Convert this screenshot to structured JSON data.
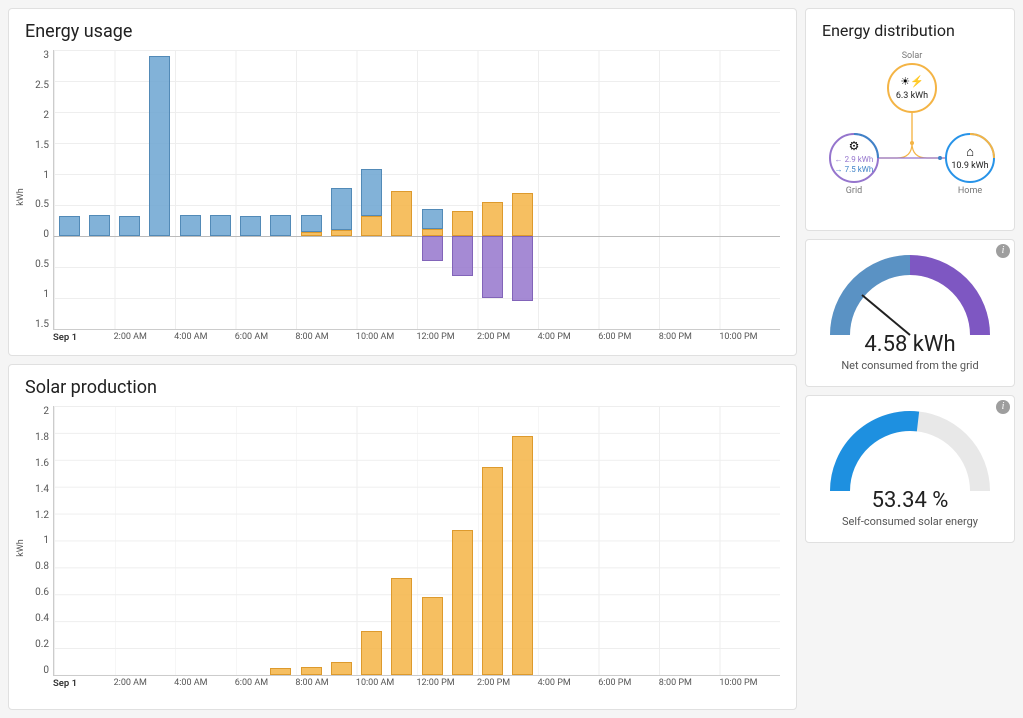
{
  "energy_usage": {
    "title": "Energy usage",
    "ylabel": "kWh"
  },
  "solar_production": {
    "title": "Solar production",
    "ylabel": "kWh"
  },
  "distribution": {
    "title": "Energy distribution",
    "solar": {
      "label": "Solar",
      "value": "6.3 kWh"
    },
    "grid": {
      "label": "Grid",
      "in": "2.9 kWh",
      "out": "7.5 kWh"
    },
    "home": {
      "label": "Home",
      "value": "10.9 kWh"
    }
  },
  "gauge_net": {
    "value": "4.58 kWh",
    "caption": "Net consumed from the grid"
  },
  "gauge_self": {
    "value": "53.34 %",
    "caption": "Self-consumed solar energy"
  },
  "chart_data": [
    {
      "id": "energy_usage",
      "type": "bar",
      "title": "Energy usage",
      "ylabel": "kWh",
      "xlabel": "",
      "ylim": [
        -1.5,
        3
      ],
      "y_ticks": [
        3,
        2.5,
        2,
        1.5,
        1,
        0.5,
        0,
        0.5,
        1,
        1.5
      ],
      "x_ticks": [
        "Sep 1",
        "2:00 AM",
        "4:00 AM",
        "6:00 AM",
        "8:00 AM",
        "10:00 AM",
        "12:00 PM",
        "2:00 PM",
        "4:00 PM",
        "6:00 PM",
        "8:00 PM",
        "10:00 PM"
      ],
      "categories": [
        "0",
        "1",
        "2",
        "3",
        "4",
        "5",
        "6",
        "7",
        "8",
        "9",
        "10",
        "11",
        "12",
        "13",
        "14",
        "15",
        "16",
        "17",
        "18",
        "19",
        "20",
        "21",
        "22",
        "23"
      ],
      "series": [
        {
          "name": "grid_import_blue",
          "color": "#6ca5d1",
          "values": [
            0.33,
            0.34,
            0.33,
            2.9,
            0.34,
            0.34,
            0.33,
            0.34,
            0.34,
            0.78,
            1.08,
            0.7,
            0.44,
            0.08,
            0,
            0,
            0,
            0,
            0,
            0,
            0,
            0,
            0,
            0
          ]
        },
        {
          "name": "solar_used_orange",
          "color": "#f4b445",
          "values": [
            0,
            0,
            0,
            0,
            0,
            0,
            0,
            0,
            0.06,
            0.1,
            0.33,
            0.72,
            0.12,
            0.4,
            0.55,
            0.7,
            0,
            0,
            0,
            0,
            0,
            0,
            0,
            0
          ]
        },
        {
          "name": "grid_export_purple_negative",
          "color": "#9575cd",
          "values": [
            0,
            0,
            0,
            0,
            0,
            0,
            0,
            0,
            0,
            0,
            0,
            0,
            -0.4,
            -0.65,
            -1.0,
            -1.05,
            0,
            0,
            0,
            0,
            0,
            0,
            0,
            0
          ]
        }
      ],
      "note": "blue bars extend from top of orange segment to top of stack; orange from 0 up; purple from 0 down"
    },
    {
      "id": "solar_production",
      "type": "bar",
      "title": "Solar production",
      "ylabel": "kWh",
      "xlabel": "",
      "ylim": [
        0,
        2.0
      ],
      "y_ticks": [
        2.0,
        1.8,
        1.6,
        1.4,
        1.2,
        1.0,
        0.8,
        0.6,
        0.4,
        0.2,
        0
      ],
      "x_ticks": [
        "Sep 1",
        "2:00 AM",
        "4:00 AM",
        "6:00 AM",
        "8:00 AM",
        "10:00 AM",
        "12:00 PM",
        "2:00 PM",
        "4:00 PM",
        "6:00 PM",
        "8:00 PM",
        "10:00 PM"
      ],
      "categories": [
        "0",
        "1",
        "2",
        "3",
        "4",
        "5",
        "6",
        "7",
        "8",
        "9",
        "10",
        "11",
        "12",
        "13",
        "14",
        "15",
        "16",
        "17",
        "18",
        "19",
        "20",
        "21",
        "22",
        "23"
      ],
      "series": [
        {
          "name": "solar_production",
          "color": "#f4b445",
          "values": [
            0,
            0,
            0,
            0,
            0,
            0,
            0,
            0.05,
            0.06,
            0.1,
            0.33,
            0.72,
            0.58,
            1.08,
            1.55,
            1.78,
            0,
            0,
            0,
            0,
            0,
            0,
            0,
            0
          ]
        }
      ]
    }
  ]
}
